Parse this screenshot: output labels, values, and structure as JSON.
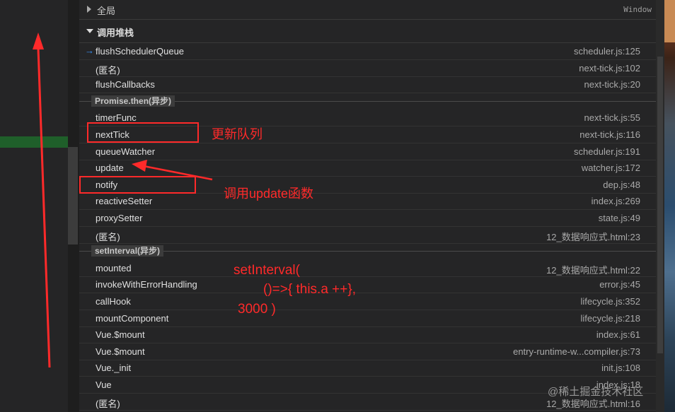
{
  "scope": {
    "label": "全局",
    "value": "Window"
  },
  "call_stack": {
    "title": "调用堆栈",
    "groups": [
      {
        "frames": [
          {
            "name": "flushSchedulerQueue",
            "location": "scheduler.js:125"
          },
          {
            "name": "(匿名)",
            "location": "next-tick.js:102"
          },
          {
            "name": "flushCallbacks",
            "location": "next-tick.js:20"
          }
        ]
      },
      {
        "async_label": "Promise.then(异步)",
        "frames": [
          {
            "name": "timerFunc",
            "location": "next-tick.js:55"
          },
          {
            "name": "nextTick",
            "location": "next-tick.js:116"
          },
          {
            "name": "queueWatcher",
            "location": "scheduler.js:191"
          },
          {
            "name": "update",
            "location": "watcher.js:172"
          },
          {
            "name": "notify",
            "location": "dep.js:48"
          },
          {
            "name": "reactiveSetter",
            "location": "index.js:269"
          },
          {
            "name": "proxySetter",
            "location": "state.js:49"
          },
          {
            "name": "(匿名)",
            "location": "12_数据响应式.html:23"
          }
        ]
      },
      {
        "async_label": "setInterval(异步)",
        "frames": [
          {
            "name": "mounted",
            "location": "12_数据响应式.html:22"
          },
          {
            "name": "invokeWithErrorHandling",
            "location": "error.js:45"
          },
          {
            "name": "callHook",
            "location": "lifecycle.js:352"
          },
          {
            "name": "mountComponent",
            "location": "lifecycle.js:218"
          },
          {
            "name": "Vue.$mount",
            "location": "index.js:61"
          },
          {
            "name": "Vue.$mount",
            "location": "entry-runtime-w...compiler.js:73"
          },
          {
            "name": "Vue._init",
            "location": "init.js:108"
          },
          {
            "name": "Vue",
            "location": "index.js:18"
          },
          {
            "name": "(匿名)",
            "location": "12_数据响应式.html:16"
          }
        ]
      }
    ]
  },
  "annotations": {
    "queue_note": "更新队列",
    "update_note": "调用update函数",
    "code_line1": "setInterval(",
    "code_line2": "()=>{ this.a ++},",
    "code_line3": "3000 )"
  },
  "watermark": "@稀土掘金技术社区",
  "colors": {
    "annotation": "#ff2a2a",
    "current_frame_arrow": "#3794ff"
  }
}
